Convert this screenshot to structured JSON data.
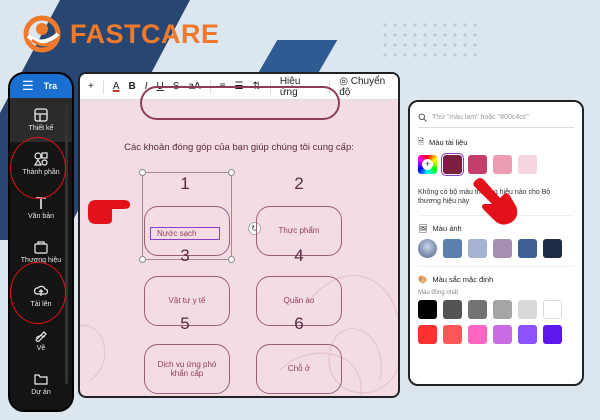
{
  "brand": {
    "name": "FASTCARE",
    "color": "#f07a2b"
  },
  "sidebar": {
    "menu_icon": "hamburger-icon",
    "top_label": "Tra",
    "items": [
      {
        "label": "Thiết kế",
        "icon": "layout-icon"
      },
      {
        "label": "Thành phần",
        "icon": "shapes-icon"
      },
      {
        "label": "Văn bản",
        "icon": "text-icon"
      },
      {
        "label": "Thương hiệu",
        "icon": "brand-icon"
      },
      {
        "label": "Tải lên",
        "icon": "upload-icon"
      },
      {
        "label": "Vẽ",
        "icon": "draw-icon"
      },
      {
        "label": "Dự án",
        "icon": "folder-icon"
      }
    ]
  },
  "toolbar": {
    "plus": "+",
    "font_color": "A",
    "bold": "B",
    "italic": "I",
    "underline": "U",
    "strike": "S",
    "case": "aA",
    "effects": "Hiệu ứng",
    "animate": "Chuyển độ"
  },
  "canvas": {
    "prompt": "Các khoản đóng góp của bạn giúp chúng tôi cung cấp:",
    "cards": [
      {
        "num": "1",
        "label": "Nước sạch"
      },
      {
        "num": "2",
        "label": "Thực phẩm"
      },
      {
        "num": "3",
        "label": "Vật tư y tế"
      },
      {
        "num": "4",
        "label": "Quần áo"
      },
      {
        "num": "5",
        "label": "Dịch vụ ứng phó khẩn cấp"
      },
      {
        "num": "6",
        "label": "Chỗ ở"
      }
    ]
  },
  "colors": {
    "search_placeholder": "Thử \"màu lam\" hoặc \"#00c4cc\"",
    "doc_title": "Màu tài liệu",
    "doc_colors": [
      "#7b1e3f",
      "#c43d6b",
      "#ee9bb4",
      "#f6d4e0"
    ],
    "brand_msg": "Không có bộ màu thương hiệu nào cho Bộ thương hiệu này",
    "photo_title": "Màu ảnh",
    "photo_colors": [
      "#5b7fae",
      "#a3b3d0",
      "#a58fb0",
      "#3e5f93",
      "#1f2c46"
    ],
    "default_title": "Màu sắc mặc định",
    "solid_label": "Màu đồng nhất",
    "default_colors": [
      "#000000",
      "#545454",
      "#737373",
      "#a6a6a6",
      "#d9d9d9",
      "#ffffff"
    ],
    "bottom_colors": [
      "#ff3131",
      "#ff5757",
      "#ff66c4",
      "#cb6ce6",
      "#8c52ff",
      "#5e17eb"
    ]
  }
}
